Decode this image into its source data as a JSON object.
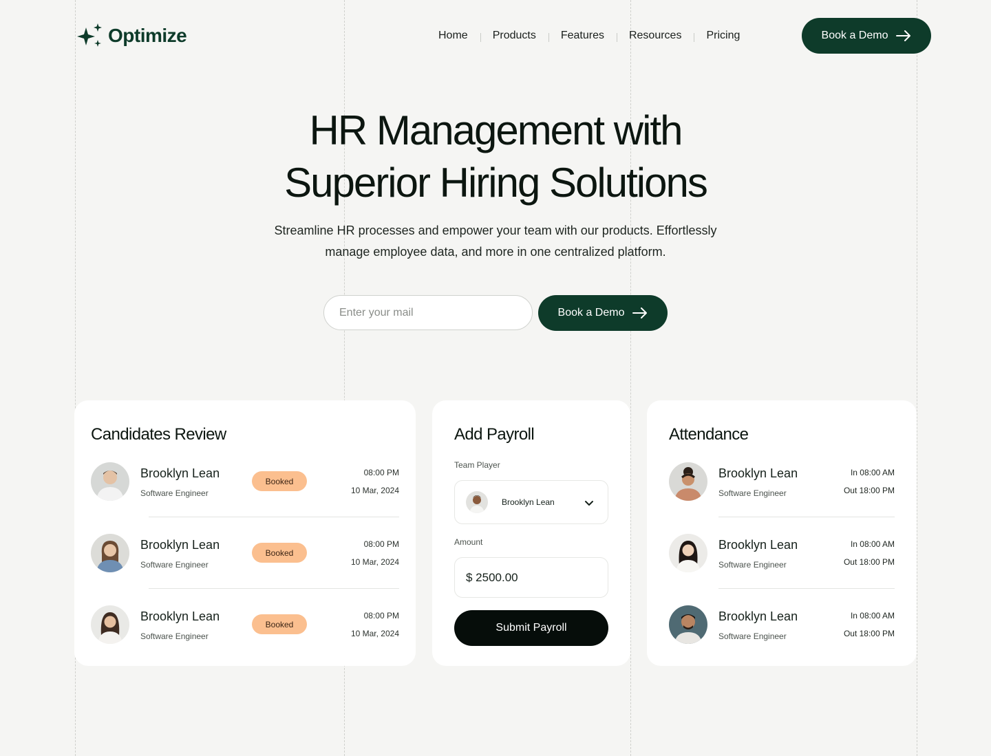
{
  "brand": {
    "name": "Optimize"
  },
  "nav": {
    "items": [
      "Home",
      "Products",
      "Features",
      "Resources",
      "Pricing"
    ],
    "cta_label": "Book a Demo"
  },
  "hero": {
    "title_line1": "HR Management with",
    "title_line2": "Superior Hiring Solutions",
    "subtitle_line1": "Streamline HR processes and empower your team with our products. Effortlessly",
    "subtitle_line2": "manage employee data, and more in one centralized platform.",
    "email_placeholder": "Enter your mail",
    "cta_label": "Book a Demo"
  },
  "candidates": {
    "title": "Candidates Review",
    "rows": [
      {
        "name": "Brooklyn Lean",
        "role": "Software Engineer",
        "status": "Booked",
        "time": "08:00 PM",
        "date": "10 Mar, 2024"
      },
      {
        "name": "Brooklyn Lean",
        "role": "Software Engineer",
        "status": "Booked",
        "time": "08:00 PM",
        "date": "10 Mar, 2024"
      },
      {
        "name": "Brooklyn Lean",
        "role": "Software Engineer",
        "status": "Booked",
        "time": "08:00 PM",
        "date": "10 Mar, 2024"
      }
    ]
  },
  "payroll": {
    "title": "Add Payroll",
    "team_label": "Team Player",
    "selected_player": "Brooklyn Lean",
    "amount_label": "Amount",
    "amount_value": "$ 2500.00",
    "submit_label": "Submit Payroll"
  },
  "attendance": {
    "title": "Attendance",
    "rows": [
      {
        "name": "Brooklyn Lean",
        "role": "Software Engineer",
        "in": "In 08:00 AM",
        "out": "Out 18:00 PM"
      },
      {
        "name": "Brooklyn Lean",
        "role": "Software Engineer",
        "in": "In 08:00 AM",
        "out": "Out 18:00 PM"
      },
      {
        "name": "Brooklyn Lean",
        "role": "Software Engineer",
        "in": "In 08:00 AM",
        "out": "Out 18:00 PM"
      }
    ]
  },
  "colors": {
    "brand_green": "#0e3b2a",
    "badge_orange": "#fbbf8f",
    "background": "#f5f5f3",
    "submit_black": "#060d0a"
  },
  "icons": [
    "sparkle-logo-icon",
    "arrow-right-icon",
    "chevron-down-icon",
    "avatar-photo"
  ]
}
